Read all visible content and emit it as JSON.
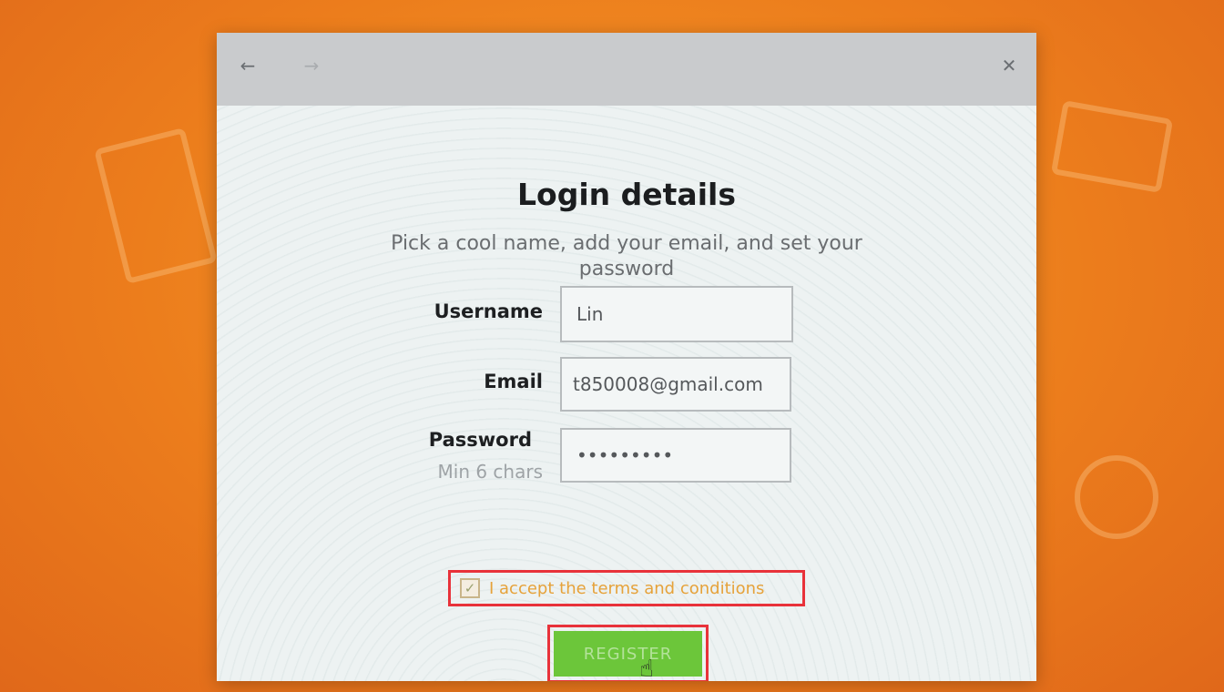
{
  "window": {
    "back_icon": "arrow-left-icon",
    "forward_icon": "arrow-right-icon",
    "close_icon": "close-icon"
  },
  "form": {
    "title": "Login details",
    "subtitle": "Pick a cool name, add your email, and set your password",
    "username_label": "Username",
    "username_value": "Lin",
    "email_label": "Email",
    "email_value": "t850008@gmail.com",
    "password_label": "Password",
    "password_hint": "Min 6 chars",
    "password_value": "123456789",
    "terms_label": "I accept the terms and conditions",
    "terms_checked": true,
    "register_label": "REGISTER"
  },
  "colors": {
    "register_green": "#6cc63a",
    "highlight_red": "#e8323a",
    "background_orange": "#f08a24"
  }
}
